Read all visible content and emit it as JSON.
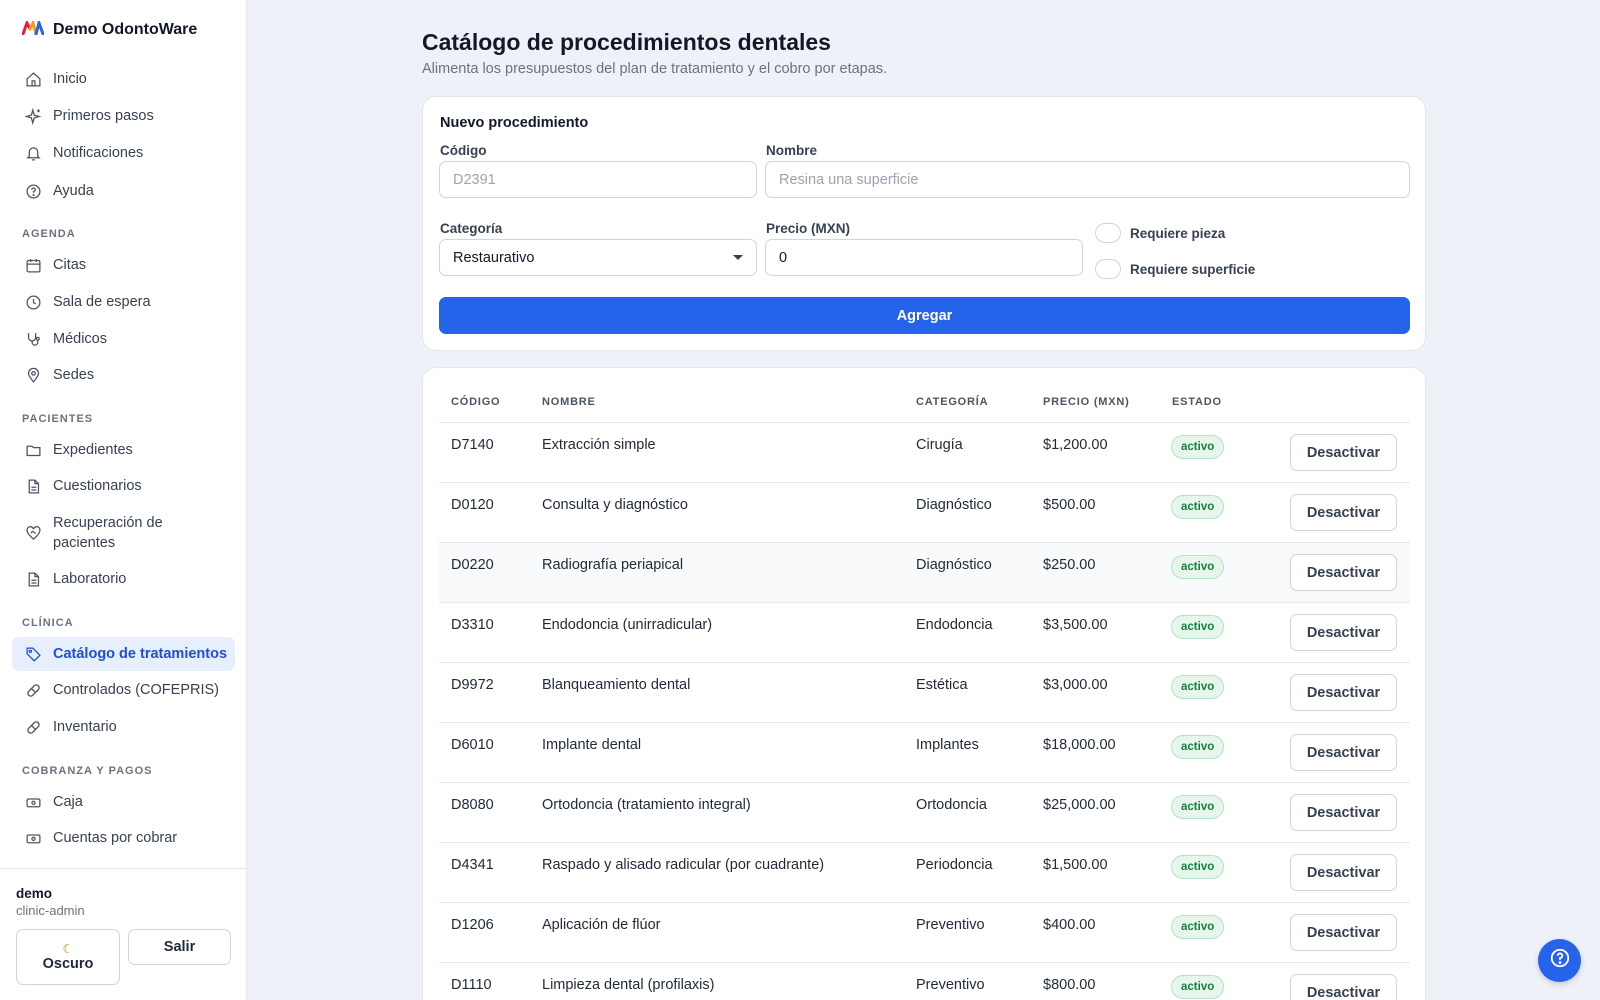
{
  "app": {
    "name": "Demo OdontoWare"
  },
  "sidebar": {
    "top_items": [
      {
        "label": "Inicio",
        "icon": "home-icon"
      },
      {
        "label": "Primeros pasos",
        "icon": "sparkle-icon"
      },
      {
        "label": "Notificaciones",
        "icon": "bell-icon"
      },
      {
        "label": "Ayuda",
        "icon": "help-circle-icon"
      }
    ],
    "sections": [
      {
        "title": "AGENDA",
        "items": [
          {
            "label": "Citas",
            "icon": "calendar-icon"
          },
          {
            "label": "Sala de espera",
            "icon": "clock-icon"
          },
          {
            "label": "Médicos",
            "icon": "stethoscope-icon"
          },
          {
            "label": "Sedes",
            "icon": "map-pin-icon"
          }
        ]
      },
      {
        "title": "PACIENTES",
        "items": [
          {
            "label": "Expedientes",
            "icon": "folder-icon"
          },
          {
            "label": "Cuestionarios",
            "icon": "document-icon"
          },
          {
            "label": "Recuperación de pacientes",
            "icon": "heart-handshake-icon"
          },
          {
            "label": "Laboratorio",
            "icon": "document-icon"
          }
        ]
      },
      {
        "title": "CLÍNICA",
        "items": [
          {
            "label": "Catálogo de tratamientos",
            "icon": "tag-icon",
            "active": true
          },
          {
            "label": "Controlados (COFEPRIS)",
            "icon": "pill-icon"
          },
          {
            "label": "Inventario",
            "icon": "pill-icon"
          }
        ]
      },
      {
        "title": "COBRANZA Y PAGOS",
        "items": [
          {
            "label": "Caja",
            "icon": "cash-icon"
          },
          {
            "label": "Cuentas por cobrar",
            "icon": "cash-icon"
          }
        ]
      }
    ],
    "user": {
      "name": "demo",
      "role": "clinic-admin"
    },
    "theme_button": "Oscuro",
    "logout_button": "Salir"
  },
  "header": {
    "title": "Catálogo de procedimientos dentales",
    "subtitle": "Alimenta los presupuestos del plan de tratamiento y el cobro por etapas."
  },
  "form": {
    "heading": "Nuevo procedimiento",
    "code_label": "Código",
    "code_placeholder": "D2391",
    "name_label": "Nombre",
    "name_placeholder": "Resina una superficie",
    "category_label": "Categoría",
    "category_value": "Restaurativo",
    "price_label": "Precio (MXN)",
    "price_value": "0",
    "requires_tooth_label": "Requiere pieza",
    "requires_tooth_checked": false,
    "requires_surface_label": "Requiere superficie",
    "requires_surface_checked": false,
    "submit_label": "Agregar"
  },
  "table": {
    "headers": [
      "CÓDIGO",
      "NOMBRE",
      "CATEGORÍA",
      "PRECIO (MXN)",
      "ESTADO"
    ],
    "action_label": "Desactivar",
    "rows": [
      {
        "code": "D7140",
        "name": "Extracción simple",
        "category": "Cirugía",
        "price": "$1,200.00",
        "status": "activo"
      },
      {
        "code": "D0120",
        "name": "Consulta y diagnóstico",
        "category": "Diagnóstico",
        "price": "$500.00",
        "status": "activo"
      },
      {
        "code": "D0220",
        "name": "Radiografía periapical",
        "category": "Diagnóstico",
        "price": "$250.00",
        "status": "activo"
      },
      {
        "code": "D3310",
        "name": "Endodoncia (unirradicular)",
        "category": "Endodoncia",
        "price": "$3,500.00",
        "status": "activo"
      },
      {
        "code": "D9972",
        "name": "Blanqueamiento dental",
        "category": "Estética",
        "price": "$3,000.00",
        "status": "activo"
      },
      {
        "code": "D6010",
        "name": "Implante dental",
        "category": "Implantes",
        "price": "$18,000.00",
        "status": "activo"
      },
      {
        "code": "D8080",
        "name": "Ortodoncia (tratamiento integral)",
        "category": "Ortodoncia",
        "price": "$25,000.00",
        "status": "activo"
      },
      {
        "code": "D4341",
        "name": "Raspado y alisado radicular (por cuadrante)",
        "category": "Periodoncia",
        "price": "$1,500.00",
        "status": "activo"
      },
      {
        "code": "D1206",
        "name": "Aplicación de flúor",
        "category": "Preventivo",
        "price": "$400.00",
        "status": "activo"
      },
      {
        "code": "D1110",
        "name": "Limpieza dental (profilaxis)",
        "category": "Preventivo",
        "price": "$800.00",
        "status": "activo"
      }
    ]
  },
  "colors": {
    "accent": "#2563eb",
    "active_nav_bg": "#e8effc",
    "status_green": "#15803d"
  }
}
